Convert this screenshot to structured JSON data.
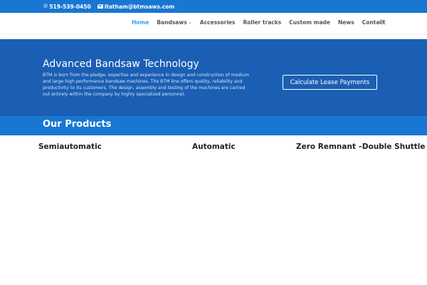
{
  "topbar": {
    "phone": "519-539-0450",
    "email": "itatham@btmsaws.com",
    "phone_icon": "phone-icon",
    "email_icon": "envelope-icon"
  },
  "nav": {
    "items": [
      "Home",
      "Bandsaws",
      "Accessories",
      "Roller tracks",
      "Custom made",
      "News",
      "Contact"
    ],
    "active": "Home",
    "search_icon": "search-icon"
  },
  "hero": {
    "title": "Advanced Bandsaw Technology",
    "text": "BTM is born from the pledge, expertise and experience in design and construction of medium and large high performance bandsaw machines. The BTM line offers quality, reliability and productivity to its customers. The design, assembly and testing of the machines are carried out entirely within the company by highly specialized personnel.",
    "button": "Calculate Lease Payments"
  },
  "products": {
    "title": "Our Products",
    "categories": [
      "Semiautomatic",
      "Automatic",
      "Zero Remnant –Double Shuttle"
    ]
  },
  "colors": {
    "topbar": "#1877d2",
    "hero": "#1a5fb4",
    "active_nav": "#2ea3f2"
  }
}
